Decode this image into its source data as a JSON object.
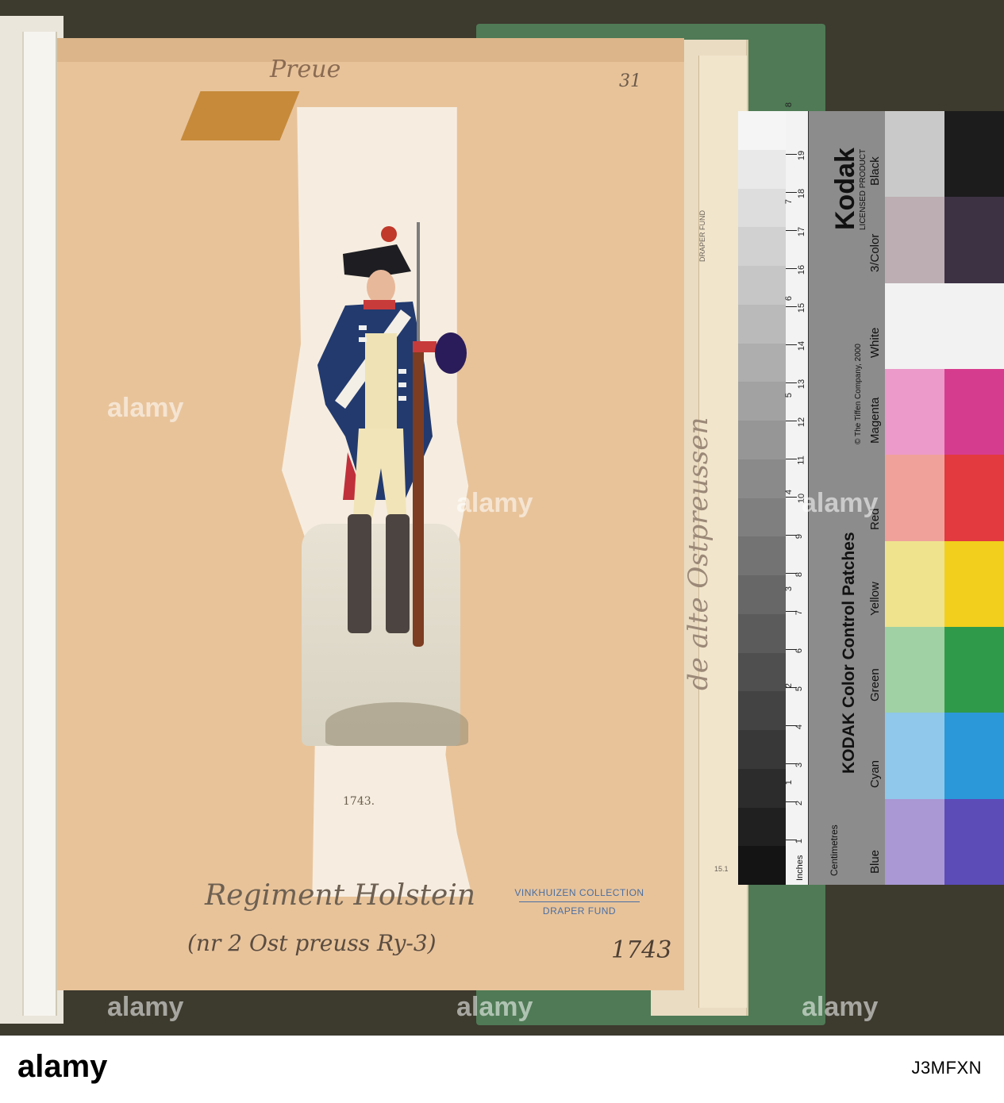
{
  "page": {
    "top_handwriting": "Preue",
    "page_number": "31",
    "plate_year": "1743.",
    "regiment_handwriting": "Regiment Holstein",
    "note_handwriting": "(nr 2 Ost preuss Ry-3)",
    "year_handwriting": "1743",
    "side_handwriting": "de alte Ostpreussen"
  },
  "stamp": {
    "collection": "VINKHUIZEN COLLECTION",
    "fund": "DRAPER FUND"
  },
  "stack": {
    "side_label": "DRAPER FUND",
    "fold_number": "15.1"
  },
  "color_card": {
    "title_kodak": "Kodak",
    "licensed": "LICENSED PRODUCT",
    "title": "KODAK Color Control Patches",
    "copyright": "© The Tiffen Company, 2000",
    "label_inches": "Inches",
    "label_cm": "Centimetres",
    "cm_ticks": [
      "1",
      "2",
      "3",
      "4",
      "5",
      "6",
      "7",
      "8",
      "9",
      "10",
      "11",
      "12",
      "13",
      "14",
      "15",
      "16",
      "17",
      "18",
      "19"
    ],
    "inch_ticks": [
      "1",
      "2",
      "3",
      "4",
      "5",
      "6",
      "7",
      "8"
    ],
    "patch_labels": [
      "Blue",
      "Cyan",
      "Green",
      "Yellow",
      "Red",
      "Magenta",
      "White",
      "3/Color",
      "Black"
    ],
    "colors": {
      "blue_light": "#a998d4",
      "blue": "#5b4cb8",
      "cyan_light": "#8fc8ea",
      "cyan": "#2b98d9",
      "green_light": "#9fd1a4",
      "green": "#2f9a4a",
      "yellow_light": "#efe38e",
      "yellow": "#f2cf1c",
      "red_light": "#f0a29a",
      "red": "#e23a3e",
      "magenta_light": "#ec9ac9",
      "magenta": "#d63c8e",
      "white": "#f2f2f2",
      "color3_light": "#bcaeb2",
      "color3": "#3d3244",
      "black_light": "#c9c9c9",
      "black": "#1c1c1c"
    }
  },
  "watermark": {
    "brand": "alamy",
    "image_id": "J3MFXN"
  }
}
